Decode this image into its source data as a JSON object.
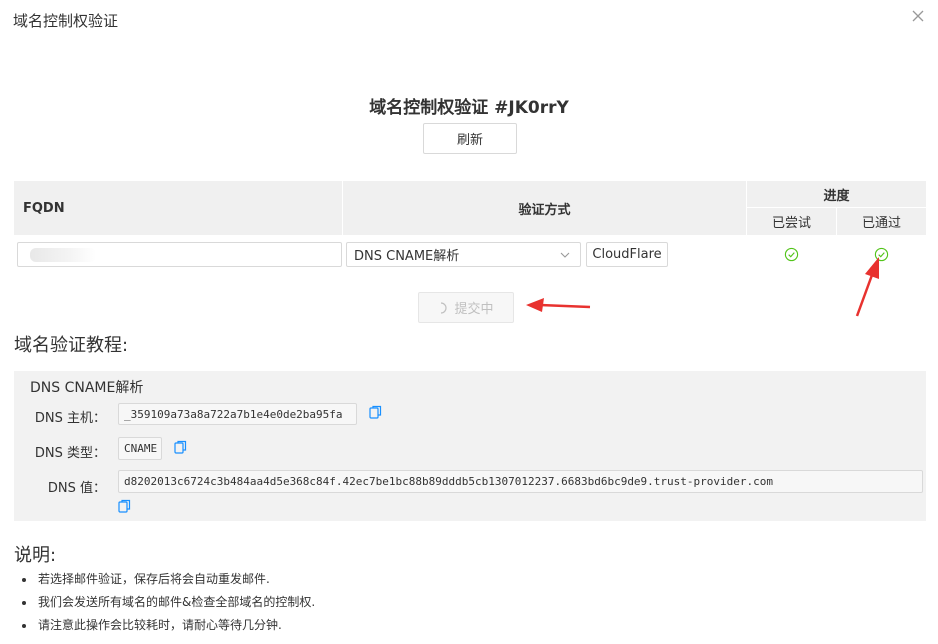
{
  "dialog": {
    "title": "域名控制权验证"
  },
  "main": {
    "title": "域名控制权验证 #JK0rrY",
    "refresh_label": "刷新"
  },
  "table": {
    "headers": {
      "fqdn": "FQDN",
      "method": "验证方式",
      "progress": "进度",
      "tried": "已尝试",
      "passed": "已通过"
    },
    "rows": [
      {
        "fqdn_value": "",
        "method_selected": "DNS CNAME解析",
        "provider_label": "CloudFlare",
        "tried": true,
        "passed": true
      }
    ]
  },
  "submit": {
    "label": "提交中"
  },
  "tutorial": {
    "heading": "域名验证教程:",
    "method_title": "DNS CNAME解析",
    "host_label": "DNS 主机：",
    "host_value": "_359109a73a8a722a7b1e4e0de2ba95fa",
    "type_label": "DNS 类型：",
    "type_value": "CNAME",
    "value_label": "DNS 值：",
    "value_value": "d8202013c6724c3b484aa4d5e368c84f.42ec7be1bc88b89dddb5cb1307012237.6683bd6bc9de9.trust-provider.com"
  },
  "notes": {
    "heading": "说明:",
    "items": [
      "若选择邮件验证，保存后将会自动重发邮件.",
      "我们会发送所有域名的邮件&检查全部域名的控制权.",
      "请注意此操作会比较耗时，请耐心等待几分钟."
    ]
  },
  "colors": {
    "success": "#52c41a",
    "annotation_arrow": "#e8322f",
    "copy_icon": "#1890ff"
  },
  "icons": [
    "close-icon",
    "chevron-down-icon",
    "check-circle-icon",
    "spinner-icon",
    "copy-icon"
  ]
}
